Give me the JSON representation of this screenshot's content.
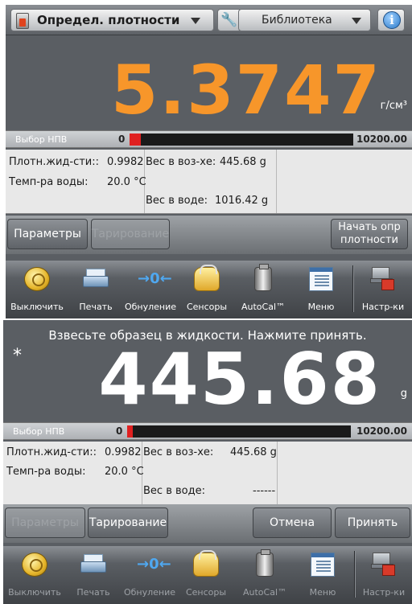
{
  "screens": [
    {
      "topbar": {
        "app_label": "Определ. плотности",
        "library_label": "Библиотека"
      },
      "readout": {
        "value": "5.3747",
        "unit": "г/см³"
      },
      "capacity": {
        "label": "Выбор НПВ",
        "min": "0",
        "max": "10200.00",
        "fill_fraction": 0.05
      },
      "info": {
        "liquid_density_label": "Плотн.жид-сти::",
        "liquid_density_value": "0.9982",
        "water_temp_label": "Темп-ра воды:",
        "water_temp_value": "20.0 °C",
        "weight_air_label": "Вес в воз-хе:",
        "weight_air_value": "445.68 g",
        "weight_water_label": "Вес в воде:",
        "weight_water_value": "1016.42 g"
      },
      "buttons": {
        "params": "Параметры",
        "tare": "Тарирование",
        "start": "Начать опр плотности"
      },
      "nav": [
        "Выключить",
        "Печать",
        "Обнуление",
        "Сенсоры",
        "AutoCal™",
        "Меню",
        "Настр-ки"
      ]
    },
    {
      "prompt": "Взвесьте образец в жидкости. Нажмите принять.",
      "stable_marker": "*",
      "readout": {
        "value": "445.68",
        "unit": "g"
      },
      "capacity": {
        "label": "Выбор НПВ",
        "min": "0",
        "max": "10200.00",
        "fill_fraction": 0.025
      },
      "info": {
        "liquid_density_label": "Плотн.жид-сти::",
        "liquid_density_value": "0.9982",
        "water_temp_label": "Темп-ра воды:",
        "water_temp_value": "20.0 °C",
        "weight_air_label": "Вес в воз-хе:",
        "weight_air_value": "445.68 g",
        "weight_water_label": "Вес в воде:",
        "weight_water_value": "------"
      },
      "buttons": {
        "params": "Параметры",
        "tare": "Тарирование",
        "cancel": "Отмена",
        "accept": "Принять"
      },
      "nav": [
        "Выключить",
        "Печать",
        "Обнуление",
        "Сенсоры",
        "AutoCal™",
        "Меню",
        "Настр-ки"
      ]
    }
  ],
  "colors": {
    "readout_orange": "#f7962a",
    "capacity_fill": "#e02020"
  }
}
